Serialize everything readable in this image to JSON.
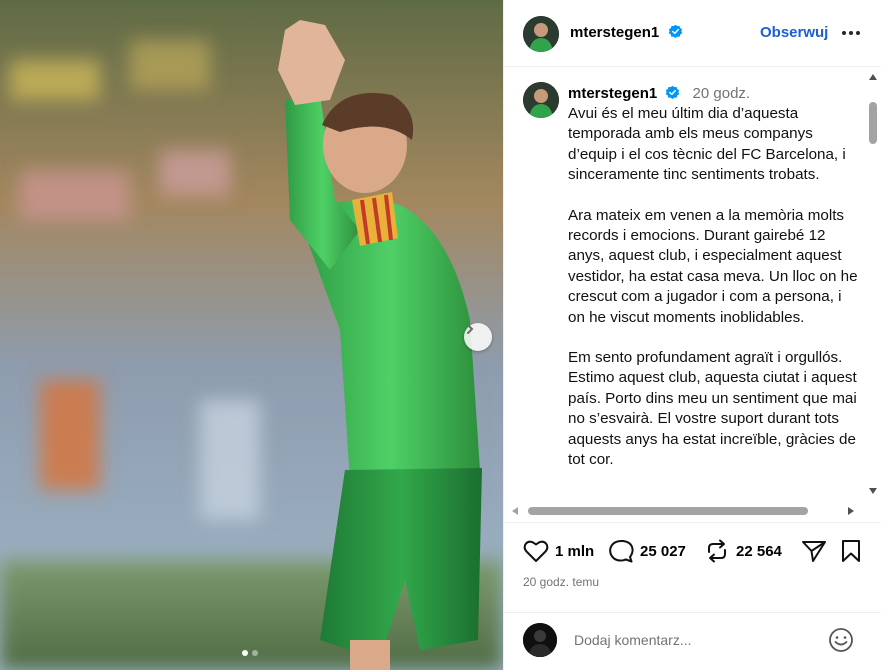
{
  "post": {
    "username": "mterstegen1",
    "follow_label": "Obserwuj",
    "caption_time": "20 godz.",
    "caption_paragraphs": [
      "Avui és el meu últim dia d’aquesta temporada amb els meus companys d’equip i el cos tècnic del FC Barcelona, i sinceramente tinc sentiments trobats.",
      "Ara mateix em venen a la memòria molts records i emocions. Durant gairebé 12 anys, aquest club, i especialment aquest vestidor, ha estat casa meva. Un lloc on he crescut com a jugador i com a persona, i on he viscut moments inoblidables.",
      "Em sento profundament agraït i orgullós. Estimo aquest club, aquesta ciutat i aquest país. Porto dins meu un sentiment que mai no s’esvairà. El vostre suport durant tots aquests anys ha estat increïble, gràcies de tot cor."
    ],
    "likes": "1 mln",
    "comments": "25 027",
    "reposts": "22 564",
    "timestamp": "20 godz. temu",
    "comment_placeholder": "Dodaj komentarz..."
  },
  "icons": {
    "verified": "verified-badge-icon",
    "more": "more-horizontal-icon",
    "like": "heart-icon",
    "comment": "comment-bubble-icon",
    "repost": "repost-icon",
    "share": "share-paper-plane-icon",
    "save": "bookmark-icon",
    "emoji": "smiley-icon",
    "next": "chevron-right-icon"
  },
  "colors": {
    "accent": "#1c5ed6",
    "verified": "#0095f6",
    "muted": "#737373",
    "jersey": "#3fbf5a"
  },
  "carousel": {
    "slide_count": 2,
    "active_slide": 1
  }
}
